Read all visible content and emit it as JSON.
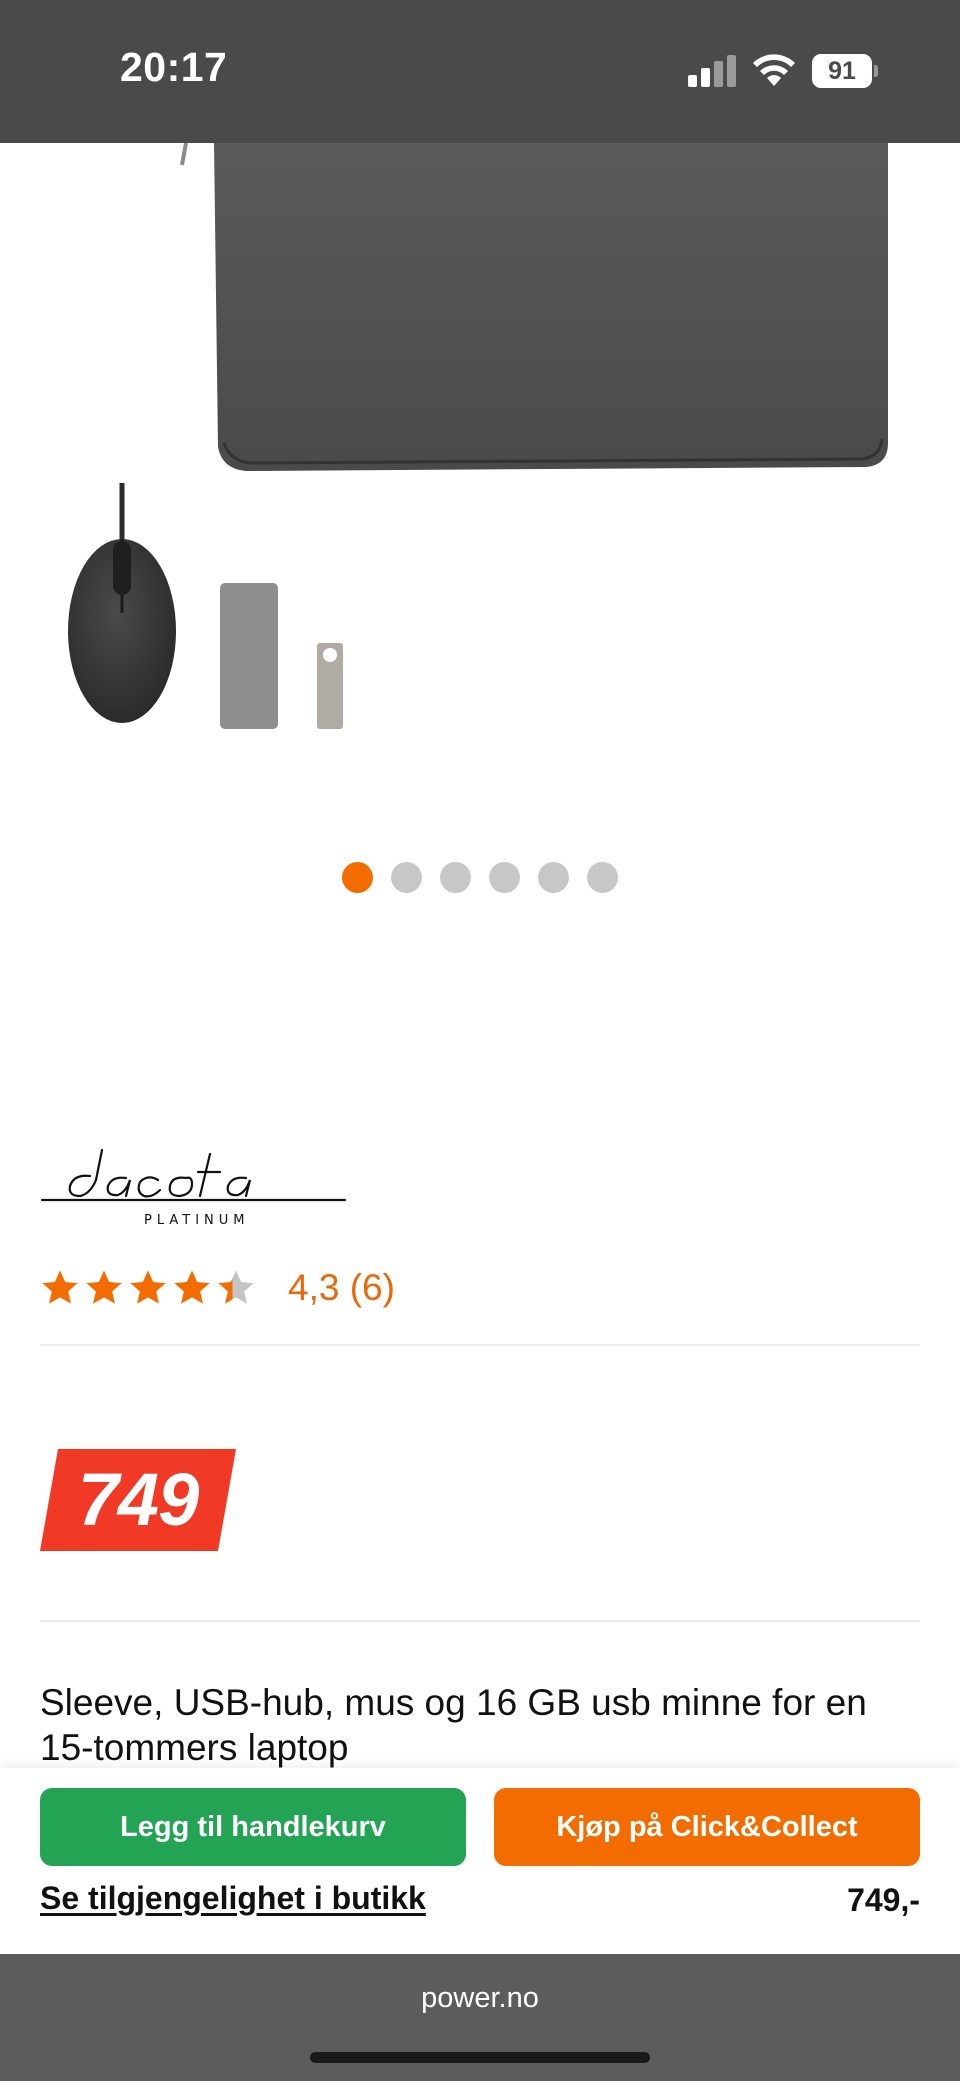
{
  "status_bar": {
    "time": "20:17",
    "battery": "91",
    "icons": [
      "signal-icon",
      "wifi-icon",
      "battery-icon"
    ]
  },
  "carousel": {
    "total": 6,
    "active_index": 0
  },
  "product": {
    "brand_logo": "dacota PLATINUM",
    "rating": {
      "value": 4.3,
      "text": "4,3 (6)",
      "stars_filled": 4.3,
      "stars_total": 5
    },
    "price": "749",
    "title": "Sleeve, USB-hub, mus og 16 GB usb minne for en 15-tommers laptop"
  },
  "actions": {
    "add_to_cart_label": "Legg til handlekurv",
    "click_collect_label": "Kjøp på Click&Collect",
    "availability_link": "Se tilgjengelighet i butikk",
    "price": "749,-"
  },
  "browser": {
    "url": "power.no"
  },
  "colors": {
    "accent_orange": "#f36c00",
    "cart_green": "#23a455",
    "price_red": "#f03a26",
    "status_bar": "#4a4a4a",
    "browser_bar": "#5c5c5c"
  }
}
